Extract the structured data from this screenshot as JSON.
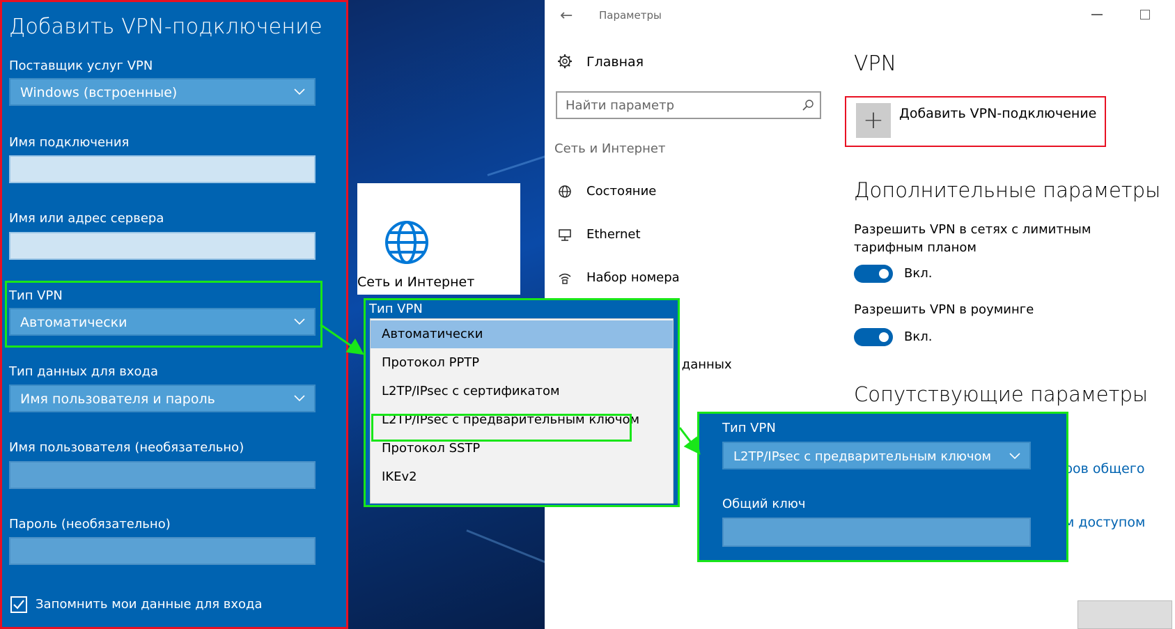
{
  "left_panel": {
    "title": "Добавить VPN-подключение",
    "provider_label": "Поставщик услуг VPN",
    "provider_value": "Windows (встроенные)",
    "connection_name_label": "Имя подключения",
    "server_label": "Имя или адрес сервера",
    "vpn_type_label": "Тип VPN",
    "vpn_type_value": "Автоматически",
    "signin_type_label": "Тип данных для входа",
    "signin_type_value": "Имя пользователя и пароль",
    "username_label": "Имя пользователя (необязательно)",
    "password_label": "Пароль (необязательно)",
    "remember_label": "Запомнить мои данные для входа",
    "remember_checked": true
  },
  "network_card": {
    "label": "Сеть и Интернет"
  },
  "settings": {
    "window_title": "Параметры",
    "home_label": "Главная",
    "search_placeholder": "Найти параметр",
    "nav_category": "Сеть и Интернет",
    "nav_items": [
      {
        "label": "Состояние",
        "icon": "globe-icon"
      },
      {
        "label": "Ethernet",
        "icon": "ethernet-icon"
      },
      {
        "label": "Набор номера",
        "icon": "dialup-icon"
      }
    ],
    "nav_partial": "е данных",
    "vpn_heading": "VPN",
    "add_vpn_label": "Добавить VPN-подключение",
    "advanced_heading": "Дополнительные параметры",
    "option_metered": "Разрешить VPN в сетях с лимитным тарифным планом",
    "option_metered_state": "Вкл.",
    "option_roaming": "Разрешить VPN в роуминге",
    "option_roaming_state": "Вкл.",
    "related_heading": "Сопутствующие параметры",
    "link1_partial": "ров общего",
    "link2_partial": "м доступом",
    "accent_color": "#0063b1"
  },
  "dropdown": {
    "title": "Тип VPN",
    "options": [
      "Автоматически",
      "Протокол PPTP",
      "L2TP/IPsec с сертификатом",
      "L2TP/IPsec с предварительным ключом",
      "Протокол SSTP",
      "IKEv2"
    ],
    "selected_index": 0
  },
  "result_panel": {
    "type_label": "Тип VPN",
    "type_value": "L2TP/IPsec с предварительным ключом",
    "key_label": "Общий ключ"
  }
}
